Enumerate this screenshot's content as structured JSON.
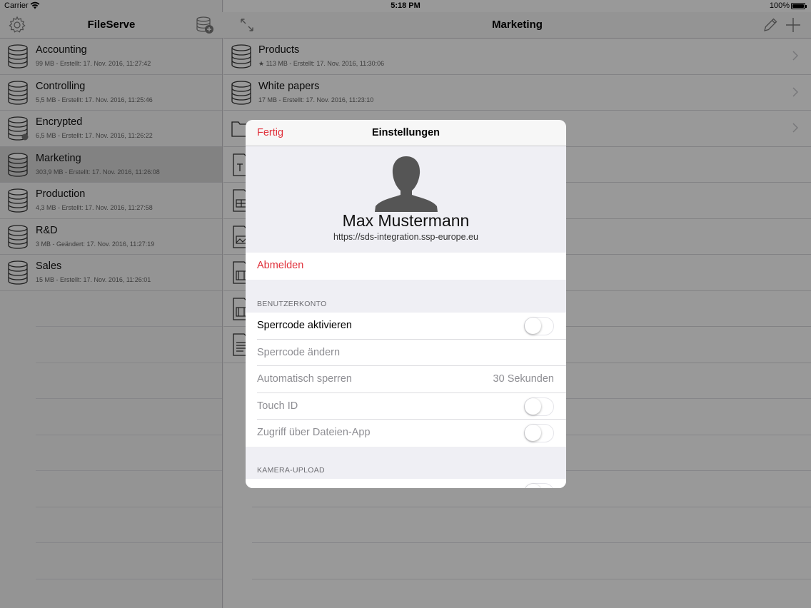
{
  "status": {
    "carrier": "Carrier",
    "time": "5:18 PM",
    "battery": "100%"
  },
  "sidebar": {
    "title": "FileServe",
    "left_icon": "gear-icon",
    "right_icon": "add-database-icon",
    "items": [
      {
        "name": "Accounting",
        "meta": "99 MB - Erstellt: 17. Nov. 2016, 11:27:42",
        "icon": "database-icon"
      },
      {
        "name": "Controlling",
        "meta": "5,5 MB - Erstellt: 17. Nov. 2016, 11:25:46",
        "icon": "database-icon"
      },
      {
        "name": "Encrypted",
        "meta": "6,5 MB - Erstellt: 17. Nov. 2016, 11:26:22",
        "icon": "encrypted-database-icon"
      },
      {
        "name": "Marketing",
        "meta": "303,9 MB - Erstellt: 17. Nov. 2016, 11:26:08",
        "icon": "database-icon",
        "selected": true
      },
      {
        "name": "Production",
        "meta": "4,3 MB - Erstellt: 17. Nov. 2016, 11:27:58",
        "icon": "database-icon"
      },
      {
        "name": "R&D",
        "meta": "3 MB - Geändert: 17. Nov. 2016, 11:27:19",
        "icon": "database-icon"
      },
      {
        "name": "Sales",
        "meta": "15 MB - Erstellt: 17. Nov. 2016, 11:26:01",
        "icon": "database-icon"
      }
    ]
  },
  "main": {
    "title": "Marketing",
    "left_icon": "expand-icon",
    "right_icons": [
      "pencil-icon",
      "plus-icon"
    ],
    "items": [
      {
        "name": "Products",
        "meta": "★ 113 MB - Erstellt: 17. Nov. 2016, 11:30:06",
        "icon": "database-icon"
      },
      {
        "name": "White papers",
        "meta": "17 MB - Erstellt: 17. Nov. 2016, 11:23:10",
        "icon": "database-icon"
      }
    ]
  },
  "modal": {
    "done_label": "Fertig",
    "title": "Einstellungen",
    "profile": {
      "avatar_icon": "user-silhouette-icon",
      "name": "Max Mustermann",
      "url": "https://sds-integration.ssp-europe.eu"
    },
    "logout_label": "Abmelden",
    "account_section": {
      "header": "BENUTZERKONTO",
      "rows": [
        {
          "label": "Sperrcode aktivieren",
          "type": "toggle",
          "on": false,
          "enabled": true
        },
        {
          "label": "Sperrcode ändern",
          "type": "link",
          "enabled": false
        },
        {
          "label": "Automatisch sperren",
          "type": "value",
          "value": "30 Sekunden",
          "enabled": false
        },
        {
          "label": "Touch ID",
          "type": "toggle",
          "on": false,
          "enabled": false
        },
        {
          "label": "Zugriff über Dateien-App",
          "type": "toggle",
          "on": false,
          "enabled": false
        }
      ]
    },
    "camera_section": {
      "header": "KAMERA-UPLOAD"
    }
  }
}
